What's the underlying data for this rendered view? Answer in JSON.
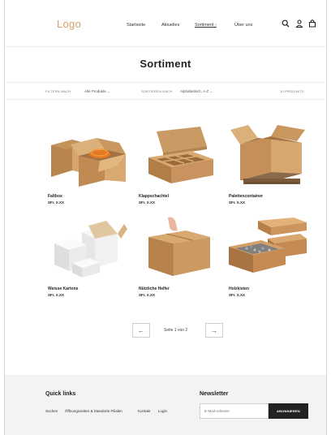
{
  "header": {
    "logo": "Logo",
    "nav": [
      "Startseite",
      "Aktuelles",
      "Sortiment",
      "Über uns"
    ]
  },
  "page": {
    "title": "Sortiment"
  },
  "filters": {
    "filter_label": "FILTERN NACH",
    "filter_value": "Alle Produkte",
    "sort_label": "SORTIEREN NACH",
    "sort_value": "Alphabetisch, A-Z",
    "count": "10 PRODUKTE"
  },
  "products": [
    {
      "name": "Faltbox",
      "price": "SFr. X.XX"
    },
    {
      "name": "Klappschachtel",
      "price": "SFr. X.XX"
    },
    {
      "name": "Palettencontainer",
      "price": "SFr. X.XX"
    },
    {
      "name": "Weisse Kartons",
      "price": "SFr. X.XX"
    },
    {
      "name": "Nützliche Helfer",
      "price": "SFr. X.XX"
    },
    {
      "name": "Holzkisten",
      "price": "SFr. X.XX"
    }
  ],
  "pagination": {
    "prev": "←",
    "label": "Seite 1 von 2",
    "next": "→"
  },
  "footer": {
    "quick_links_title": "Quick links",
    "links": [
      "Suchen",
      "Öffnungszeiten & Standorte Filialen",
      "Kontakt",
      "Login"
    ],
    "newsletter_title": "Newsletter",
    "email_placeholder": "E-Mail-Adresse",
    "subscribe_label": "ABONNIEREN"
  },
  "colors": {
    "logo": "#d1a16a",
    "cardboard": "#c99a63",
    "button": "#222222",
    "footer_bg": "#f3f3f3"
  },
  "icons": [
    "search-icon",
    "account-icon",
    "cart-icon"
  ]
}
